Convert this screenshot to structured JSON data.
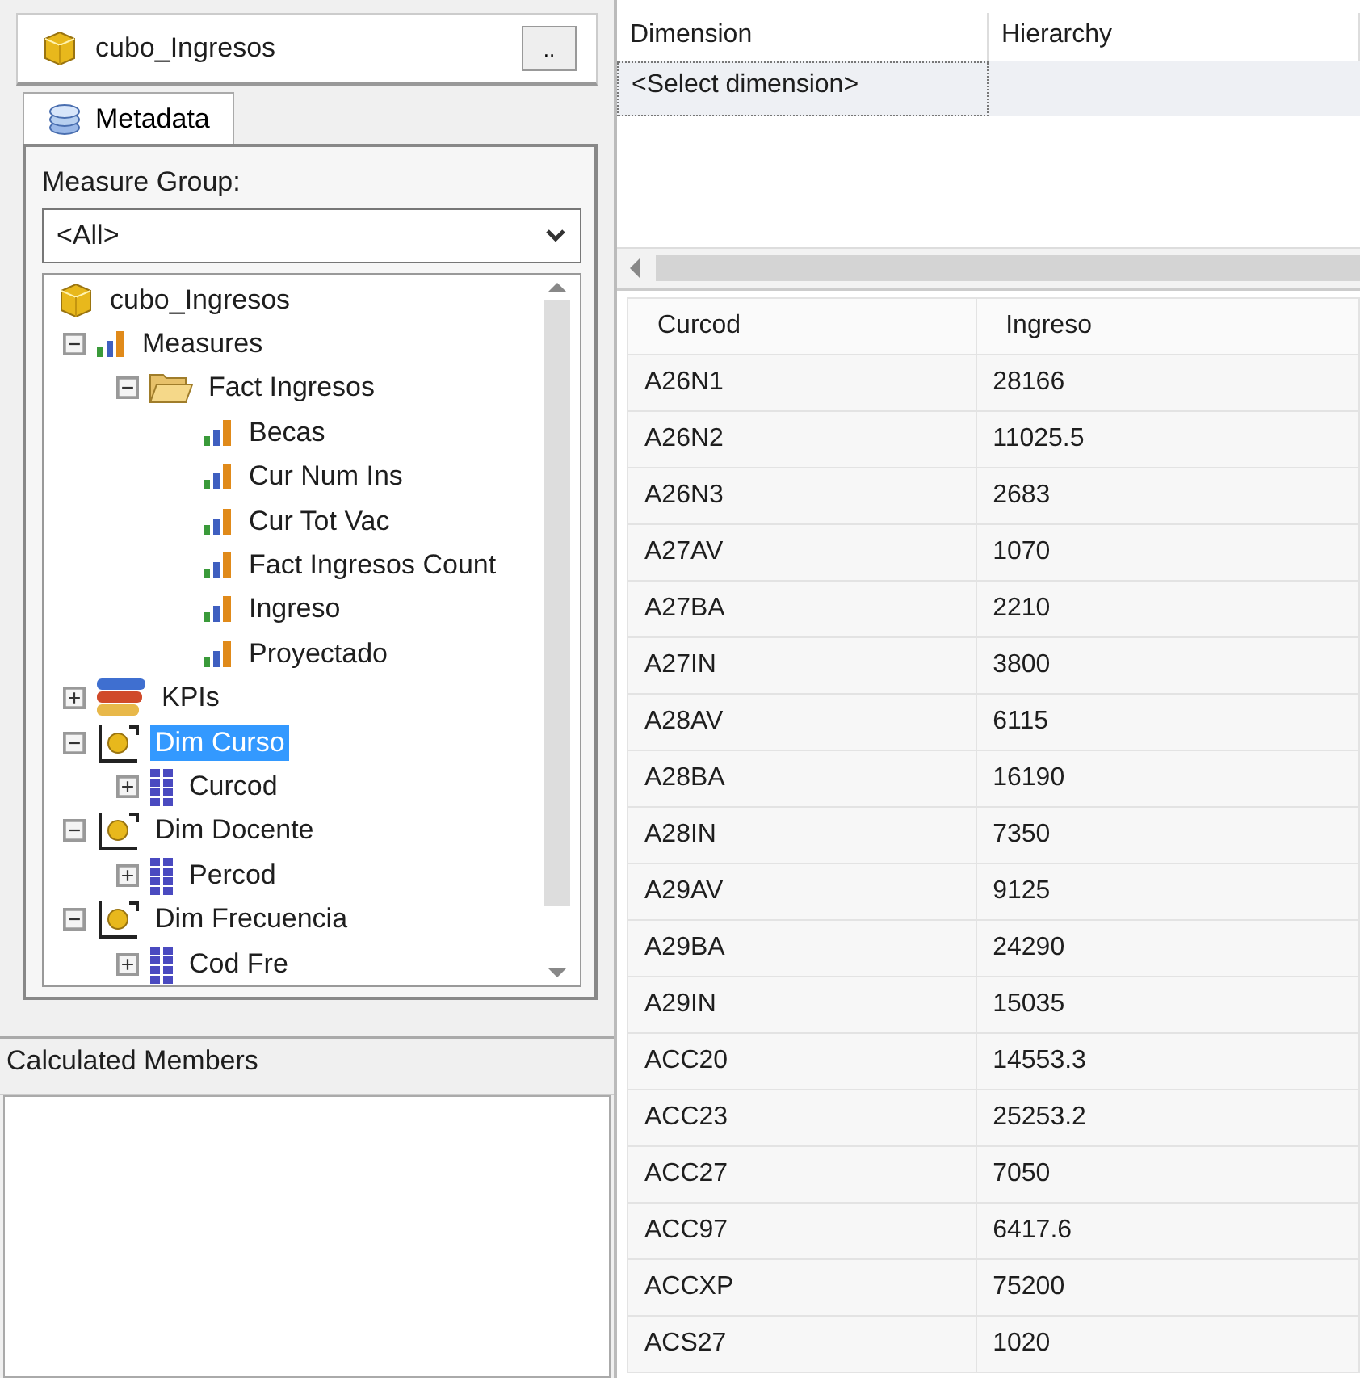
{
  "cube_bar": {
    "title": "cubo_Ingresos",
    "browse_button": ".."
  },
  "tabs": [
    {
      "label": "Metadata",
      "selected": true
    }
  ],
  "measure_group": {
    "label": "Measure Group:",
    "value": "<All>"
  },
  "tree": [
    {
      "label": "cubo_Ingresos",
      "kind": "cube",
      "selected": false,
      "children": [
        {
          "label": "Measures",
          "kind": "measures",
          "expanded": true,
          "selected": false,
          "children": [
            {
              "label": "Fact Ingresos",
              "kind": "folder",
              "expanded": true,
              "selected": false,
              "children": [
                {
                  "label": "Becas",
                  "kind": "measure",
                  "selected": false
                },
                {
                  "label": "Cur Num Ins",
                  "kind": "measure",
                  "selected": false
                },
                {
                  "label": "Cur Tot Vac",
                  "kind": "measure",
                  "selected": false
                },
                {
                  "label": "Fact Ingresos Count",
                  "kind": "measure",
                  "selected": false
                },
                {
                  "label": "Ingreso",
                  "kind": "measure",
                  "selected": false
                },
                {
                  "label": "Proyectado",
                  "kind": "measure",
                  "selected": false
                }
              ]
            }
          ]
        },
        {
          "label": "KPIs",
          "kind": "kpi",
          "expanded": false,
          "selected": false
        },
        {
          "label": "Dim Curso",
          "kind": "dimension",
          "expanded": true,
          "selected": true,
          "children": [
            {
              "label": "Curcod",
              "kind": "attribute",
              "expanded": false,
              "selected": false
            }
          ]
        },
        {
          "label": "Dim Docente",
          "kind": "dimension",
          "expanded": true,
          "selected": false,
          "children": [
            {
              "label": "Percod",
              "kind": "attribute",
              "expanded": false,
              "selected": false
            }
          ]
        },
        {
          "label": "Dim Frecuencia",
          "kind": "dimension",
          "expanded": true,
          "selected": false,
          "children": [
            {
              "label": "Cod Fre",
              "kind": "attribute",
              "expanded": false,
              "selected": false
            }
          ]
        }
      ]
    }
  ],
  "calculated_members": {
    "title": "Calculated Members"
  },
  "filter_grid": {
    "columns": [
      "Dimension",
      "Hierarchy"
    ],
    "rows": [
      {
        "dimension": "<Select dimension>"
      }
    ]
  },
  "results": {
    "columns": [
      "Curcod",
      "Ingreso"
    ],
    "rows": [
      [
        "A26N1",
        "28166"
      ],
      [
        "A26N2",
        "11025.5"
      ],
      [
        "A26N3",
        "2683"
      ],
      [
        "A27AV",
        "1070"
      ],
      [
        "A27BA",
        "2210"
      ],
      [
        "A27IN",
        "3800"
      ],
      [
        "A28AV",
        "6115"
      ],
      [
        "A28BA",
        "16190"
      ],
      [
        "A28IN",
        "7350"
      ],
      [
        "A29AV",
        "9125"
      ],
      [
        "A29BA",
        "24290"
      ],
      [
        "A29IN",
        "15035"
      ],
      [
        "ACC20",
        "14553.3"
      ],
      [
        "ACC23",
        "25253.2"
      ],
      [
        "ACC27",
        "7050"
      ],
      [
        "ACC97",
        "6417.6"
      ],
      [
        "ACCXP",
        "75200"
      ],
      [
        "ACS27",
        "1020"
      ]
    ]
  }
}
